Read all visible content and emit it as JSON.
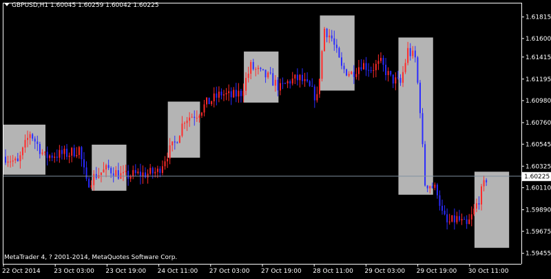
{
  "header": {
    "symbol": "GBPUSD,H1",
    "open": "1.60045",
    "high": "1.60259",
    "low": "1.60042",
    "close": "1.60225"
  },
  "copyright": "MetaTrader 4, ? 2001-2014, MetaQuotes Software Corp.",
  "colors": {
    "background": "#000000",
    "bull": "#ff2a2a",
    "bear": "#2a2aff",
    "box": "#b4b4b4",
    "axis": "#ffffff",
    "current_line": "#8090a0",
    "price_label_bg": "#ffffff",
    "price_label_fg": "#000000"
  },
  "chart_data": {
    "type": "candlestick",
    "ylim": [
      1.5935,
      1.6195
    ],
    "y_ticks": [
      "1.61815",
      "1.61600",
      "1.61415",
      "1.61195",
      "1.60980",
      "1.60760",
      "1.60545",
      "1.60325",
      "1.60110",
      "1.59890",
      "1.59675",
      "1.59455"
    ],
    "x_ticks": [
      "22 Oct 2014",
      "23 Oct 03:00",
      "23 Oct 19:00",
      "24 Oct 11:00",
      "27 Oct 03:00",
      "27 Oct 19:00",
      "28 Oct 11:00",
      "29 Oct 03:00",
      "29 Oct 19:00",
      "30 Oct 11:00"
    ],
    "current_price": "1.60225",
    "x_count": 210,
    "boxes": [
      {
        "x0": 0,
        "x1": 16,
        "y_low": 1.6024,
        "y_high": 1.6074
      },
      {
        "x0": 36,
        "x1": 49,
        "y_low": 1.6008,
        "y_high": 1.6054
      },
      {
        "x0": 67,
        "x1": 79,
        "y_low": 1.6041,
        "y_high": 1.6097
      },
      {
        "x0": 98,
        "x1": 111,
        "y_low": 1.6096,
        "y_high": 1.6147
      },
      {
        "x0": 129,
        "x1": 142,
        "y_low": 1.6108,
        "y_high": 1.6183
      },
      {
        "x0": 161,
        "x1": 174,
        "y_low": 1.6004,
        "y_high": 1.6161
      },
      {
        "x0": 192,
        "x1": 205,
        "y_low": 1.5951,
        "y_high": 1.6027
      }
    ],
    "anchors": [
      [
        0,
        1.6042
      ],
      [
        5,
        1.6035
      ],
      [
        10,
        1.6066
      ],
      [
        16,
        1.6042
      ],
      [
        20,
        1.6044
      ],
      [
        26,
        1.6045
      ],
      [
        30,
        1.605
      ],
      [
        33,
        1.6015
      ],
      [
        37,
        1.6024
      ],
      [
        42,
        1.603
      ],
      [
        48,
        1.6022
      ],
      [
        52,
        1.6024
      ],
      [
        58,
        1.6025
      ],
      [
        62,
        1.6027
      ],
      [
        66,
        1.6045
      ],
      [
        69,
        1.6055
      ],
      [
        73,
        1.608
      ],
      [
        78,
        1.6085
      ],
      [
        82,
        1.6095
      ],
      [
        88,
        1.6105
      ],
      [
        92,
        1.6102
      ],
      [
        96,
        1.6106
      ],
      [
        100,
        1.6132
      ],
      [
        104,
        1.6125
      ],
      [
        108,
        1.612
      ],
      [
        112,
        1.611
      ],
      [
        116,
        1.6118
      ],
      [
        120,
        1.612
      ],
      [
        124,
        1.611
      ],
      [
        127,
        1.61
      ],
      [
        130,
        1.617
      ],
      [
        133,
        1.616
      ],
      [
        137,
        1.613
      ],
      [
        141,
        1.6125
      ],
      [
        145,
        1.6135
      ],
      [
        149,
        1.613
      ],
      [
        153,
        1.6135
      ],
      [
        157,
        1.612
      ],
      [
        161,
        1.6115
      ],
      [
        164,
        1.6148
      ],
      [
        167,
        1.614
      ],
      [
        169,
        1.609
      ],
      [
        170,
        1.605
      ],
      [
        171,
        1.6015
      ],
      [
        173,
        1.6014
      ],
      [
        176,
        1.6008
      ],
      [
        178,
        1.5985
      ],
      [
        180,
        1.5975
      ],
      [
        184,
        1.598
      ],
      [
        188,
        1.5972
      ],
      [
        190,
        1.5982
      ],
      [
        193,
        1.6
      ],
      [
        196,
        1.602
      ]
    ]
  }
}
